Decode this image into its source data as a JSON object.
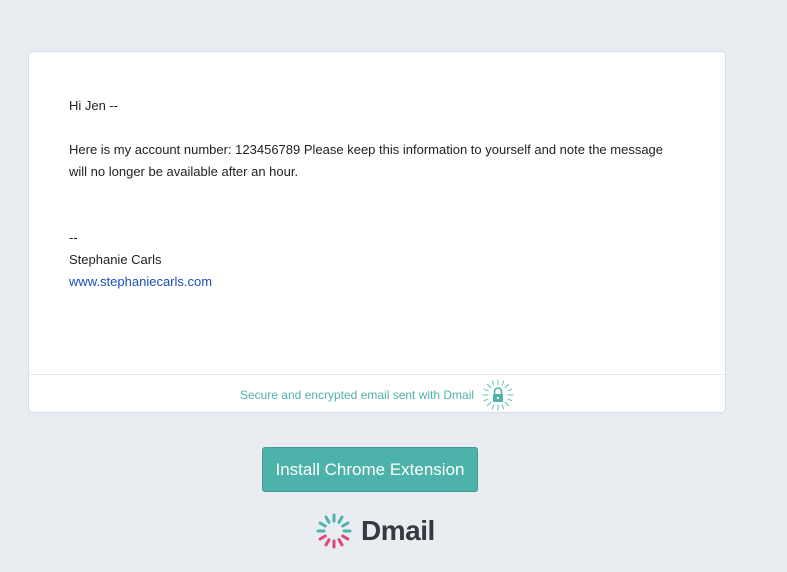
{
  "email": {
    "greeting": "Hi Jen --",
    "body": "Here is my account number: 123456789  Please keep this information to yourself and note the message will no longer be available after an hour.",
    "signature_dash": "--",
    "signature_name": "Stephanie Carls",
    "signature_link": "www.stephaniecarls.com"
  },
  "footer": {
    "text": "Secure and encrypted email sent with Dmail",
    "icon": "lock-icon"
  },
  "install_button": {
    "label": "Install Chrome Extension"
  },
  "brand": {
    "name": "Dmail",
    "icon": "dmail-logo-icon",
    "accent_color": "#4db3aa"
  }
}
